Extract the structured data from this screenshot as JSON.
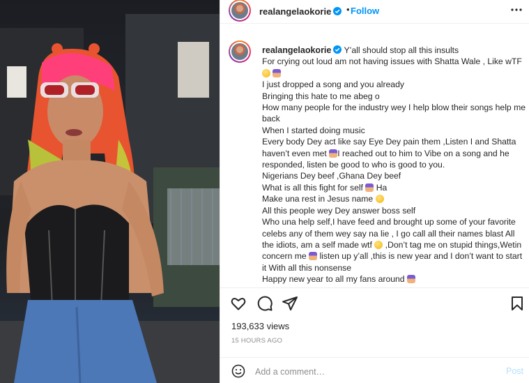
{
  "post": {
    "username": "realangelaokorie",
    "follow_label": "Follow",
    "separator": "•"
  },
  "caption": {
    "username": "realangelaokorie",
    "lines": [
      "Y’all should stop all this insults",
      "For crying out loud am not having issues with Shatta Wale , Like wTF",
      "I just dropped a song and you already",
      "Bringing this hate to me abeg o",
      "How many people for the industry wey I help blow their songs help me back",
      "When I started doing music",
      "Every body Dey act like say Eye Dey pain them ,Listen I and Shatta haven’t even met",
      "I reached out to him to Vibe on a song and he responded, listen be good to who is good to you.",
      "Nigerians Dey beef ,Ghana Dey beef",
      "What is all this fight for self",
      "Ha",
      "Make una rest in Jesus name",
      "All this people wey Dey answer boss self",
      "Who una help self,I have feed and brought up some of your favorite celebs any of them wey say na lie , I go call all their names blast All the idiots, am a self made wtf",
      ",Don’t tag me on stupid things,Wetin concern me",
      "listen up y’all ,this is new year and I don’t want to start it With all this nonsense",
      "Happy new year to all my fans around"
    ]
  },
  "icons": {
    "like": "heart-icon",
    "comment": "comment-icon",
    "share": "share-icon",
    "save": "bookmark-icon",
    "emoji": "smiley-icon",
    "more": "more-options-icon",
    "verified": "verified-badge-icon"
  },
  "stats": {
    "views": "193,633 views",
    "time": "15 HOURS AGO"
  },
  "comment_box": {
    "placeholder": "Add a comment…",
    "post_label": "Post"
  },
  "colors": {
    "accent": "#0095f6",
    "post_disabled": "#b2dffc",
    "secondary_text": "#8e8e8e"
  }
}
